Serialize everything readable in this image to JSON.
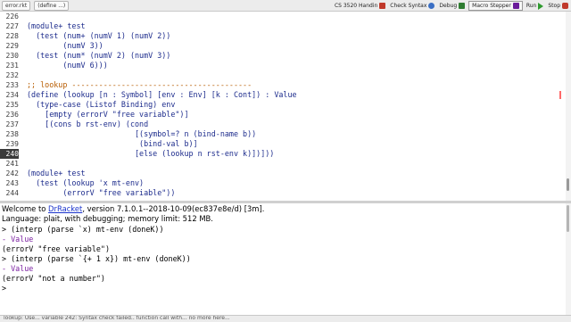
{
  "toolbar": {
    "file_menu": "error.rkt",
    "define_menu": "(define ...)",
    "course": "CS 3520 Handin",
    "check_syntax": "Check Syntax",
    "debug": "Debug",
    "macro_stepper": "Macro Stepper",
    "run": "Run",
    "stop": "Stop"
  },
  "definitions": {
    "lines": [
      {
        "n": "226",
        "code": "",
        "kind": "code"
      },
      {
        "n": "227",
        "code": "(module+ test",
        "kind": "code"
      },
      {
        "n": "228",
        "code": "  (test (num+ (numV 1) (numV 2))",
        "kind": "code"
      },
      {
        "n": "229",
        "code": "        (numV 3))",
        "kind": "code"
      },
      {
        "n": "230",
        "code": "  (test (num* (numV 2) (numV 3))",
        "kind": "code"
      },
      {
        "n": "231",
        "code": "        (numV 6)))",
        "kind": "code"
      },
      {
        "n": "232",
        "code": "",
        "kind": "code"
      },
      {
        "n": "233",
        "code": ";; lookup ----------------------------------------",
        "kind": "cmt"
      },
      {
        "n": "234",
        "code": "(define (lookup [n : Symbol] [env : Env] [k : Cont]) : Value",
        "kind": "code"
      },
      {
        "n": "235",
        "code": "  (type-case (Listof Binding) env",
        "kind": "code"
      },
      {
        "n": "236",
        "code": "    [empty (errorV \"free variable\")]",
        "kind": "code"
      },
      {
        "n": "237",
        "code": "    [(cons b rst-env) (cond",
        "kind": "code"
      },
      {
        "n": "238",
        "code": "                        [(symbol=? n (bind-name b))",
        "kind": "code"
      },
      {
        "n": "239",
        "code": "                         (bind-val b)]",
        "kind": "code"
      },
      {
        "n": "240",
        "code": "                        [else (lookup n rst-env k)])]))",
        "kind": "code"
      },
      {
        "n": "241",
        "code": "",
        "kind": "code"
      },
      {
        "n": "242",
        "code": "(module+ test",
        "kind": "code"
      },
      {
        "n": "243",
        "code": "  (test (lookup 'x mt-env)",
        "kind": "code"
      },
      {
        "n": "244",
        "code": "        (errorV \"free variable\"))",
        "kind": "code"
      }
    ],
    "current_line": "240"
  },
  "repl": {
    "welcome_prefix": "Welcome to ",
    "welcome_link": "DrRacket",
    "welcome_suffix": ", version 7.1.0.1--2018-10-09(ec837e8e/d) [3m].",
    "language_line": "Language: plait, with debugging; memory limit: 512 MB.",
    "lines": [
      {
        "text": "> (interp (parse `x) mt-env (doneK))",
        "kind": "input"
      },
      {
        "text": "- Value",
        "kind": "type"
      },
      {
        "text": "(errorV \"free variable\")",
        "kind": "result"
      },
      {
        "text": "> (interp (parse `{+ 1 x}) mt-env (doneK))",
        "kind": "input"
      },
      {
        "text": "- Value",
        "kind": "type"
      },
      {
        "text": "(errorV \"not a number\")",
        "kind": "result"
      },
      {
        "text": ">",
        "kind": "input"
      }
    ]
  },
  "status_text": "lookup: Use... variable 242: Syntax check failed.. function call with... no more here...",
  "colors": {
    "keyword": "#1c2b8c",
    "comment": "#b85c00",
    "current_line_bg": "#3a3a3a",
    "link": "#1a33cc",
    "stop_button": "#c0392b"
  }
}
